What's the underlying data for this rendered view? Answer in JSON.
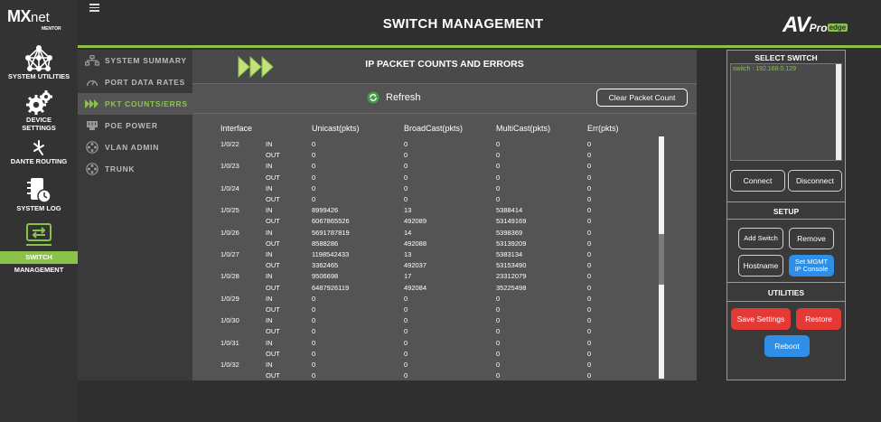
{
  "brand": {
    "mx": "MX",
    "net": "net",
    "mentor": "MENTOR",
    "av": "AV",
    "pro": "Pro",
    "edge": "edge"
  },
  "header": {
    "title": "SWITCH MANAGEMENT"
  },
  "rail": [
    {
      "label": "SYSTEM UTILITIES",
      "icon": "network-globe-icon"
    },
    {
      "label_line1": "DEVICE",
      "label_line2": "SETTINGS",
      "icon": "gears-icon"
    },
    {
      "label": "DANTE ROUTING",
      "icon": "dante-icon"
    },
    {
      "label": "SYSTEM LOG",
      "icon": "log-clock-icon"
    },
    {
      "label": "SWITCH MANAGEMENT",
      "icon": "switch-arrows-icon",
      "active": true
    }
  ],
  "submenu": [
    {
      "label": "SYSTEM SUMMARY",
      "icon": "network-icon"
    },
    {
      "label": "PORT DATA RATES",
      "icon": "speedometer-icon"
    },
    {
      "label": "PKT COUNTS/ERRS",
      "icon": "triple-arrow-icon",
      "active": true
    },
    {
      "label": "POE POWER",
      "icon": "poe-port-icon"
    },
    {
      "label": "VLAN ADMIN",
      "icon": "vlan-icon"
    },
    {
      "label": "TRUNK",
      "icon": "trunk-icon"
    }
  ],
  "main": {
    "title": "IP PACKET COUNTS AND ERRORS",
    "refresh_label": "Refresh",
    "clear_label": "Clear Packet Count",
    "columns": [
      "Interface",
      "Unicast(pkts)",
      "BroadCast(pkts)",
      "MultiCast(pkts)",
      "Err(pkts)"
    ],
    "rows": [
      {
        "iface": "1/0/22",
        "dir": "IN",
        "uni": "0",
        "bc": "0",
        "mc": "0",
        "err": "0"
      },
      {
        "iface": "",
        "dir": "OUT",
        "uni": "0",
        "bc": "0",
        "mc": "0",
        "err": "0"
      },
      {
        "iface": "1/0/23",
        "dir": "IN",
        "uni": "0",
        "bc": "0",
        "mc": "0",
        "err": "0"
      },
      {
        "iface": "",
        "dir": "OUT",
        "uni": "0",
        "bc": "0",
        "mc": "0",
        "err": "0"
      },
      {
        "iface": "1/0/24",
        "dir": "IN",
        "uni": "0",
        "bc": "0",
        "mc": "0",
        "err": "0"
      },
      {
        "iface": "",
        "dir": "OUT",
        "uni": "0",
        "bc": "0",
        "mc": "0",
        "err": "0"
      },
      {
        "iface": "1/0/25",
        "dir": "IN",
        "uni": "8999426",
        "bc": "13",
        "mc": "5388414",
        "err": "0"
      },
      {
        "iface": "",
        "dir": "OUT",
        "uni": "6067865526",
        "bc": "492089",
        "mc": "53149169",
        "err": "0"
      },
      {
        "iface": "1/0/26",
        "dir": "IN",
        "uni": "5691787819",
        "bc": "14",
        "mc": "5398369",
        "err": "0"
      },
      {
        "iface": "",
        "dir": "OUT",
        "uni": "8588286",
        "bc": "492088",
        "mc": "53139209",
        "err": "0"
      },
      {
        "iface": "1/0/27",
        "dir": "IN",
        "uni": "1198542433",
        "bc": "13",
        "mc": "5383134",
        "err": "0"
      },
      {
        "iface": "",
        "dir": "OUT",
        "uni": "3362465",
        "bc": "492037",
        "mc": "53153490",
        "err": "0"
      },
      {
        "iface": "1/0/28",
        "dir": "IN",
        "uni": "9506698",
        "bc": "17",
        "mc": "23312079",
        "err": "0"
      },
      {
        "iface": "",
        "dir": "OUT",
        "uni": "6487926119",
        "bc": "492084",
        "mc": "35225498",
        "err": "0"
      },
      {
        "iface": "1/0/29",
        "dir": "IN",
        "uni": "0",
        "bc": "0",
        "mc": "0",
        "err": "0"
      },
      {
        "iface": "",
        "dir": "OUT",
        "uni": "0",
        "bc": "0",
        "mc": "0",
        "err": "0"
      },
      {
        "iface": "1/0/30",
        "dir": "IN",
        "uni": "0",
        "bc": "0",
        "mc": "0",
        "err": "0"
      },
      {
        "iface": "",
        "dir": "OUT",
        "uni": "0",
        "bc": "0",
        "mc": "0",
        "err": "0"
      },
      {
        "iface": "1/0/31",
        "dir": "IN",
        "uni": "0",
        "bc": "0",
        "mc": "0",
        "err": "0"
      },
      {
        "iface": "",
        "dir": "OUT",
        "uni": "0",
        "bc": "0",
        "mc": "0",
        "err": "0"
      },
      {
        "iface": "1/0/32",
        "dir": "IN",
        "uni": "0",
        "bc": "0",
        "mc": "0",
        "err": "0"
      },
      {
        "iface": "",
        "dir": "OUT",
        "uni": "0",
        "bc": "0",
        "mc": "0",
        "err": "0"
      }
    ]
  },
  "right": {
    "select_title": "SELECT SWITCH",
    "switch_item": "switch : 192.168.0.129",
    "connect": "Connect",
    "disconnect": "Disconnect",
    "setup_title": "SETUP",
    "add_switch": "Add Switch",
    "remove": "Remove",
    "hostname": "Hostname",
    "set_mgmt_line1": "Set MGMT",
    "set_mgmt_line2": "IP Console",
    "utilities_title": "UTILITIES",
    "save_settings": "Save Settings",
    "restore": "Restore",
    "reboot": "Reboot"
  },
  "colors": {
    "accent": "#8bc34a",
    "background": "#2f2f2f",
    "panel": "#545454",
    "red": "#e53935",
    "blue": "#2f8fe6"
  }
}
